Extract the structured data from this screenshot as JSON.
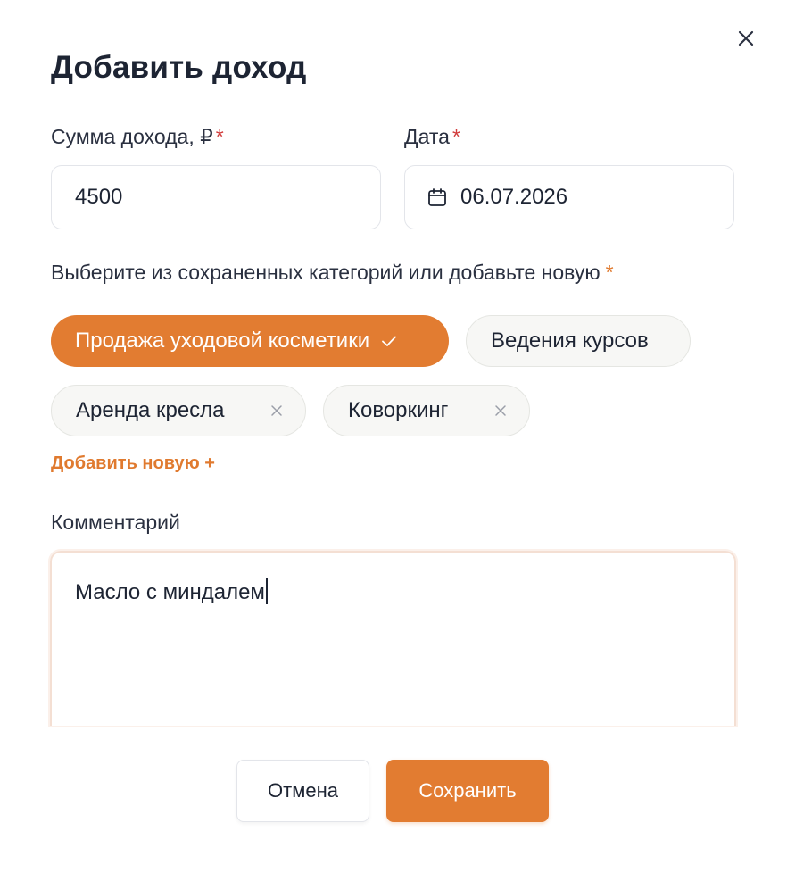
{
  "dialog": {
    "title": "Добавить доход",
    "close_icon": "close-icon"
  },
  "form": {
    "amount": {
      "label": "Сумма дохода, ₽",
      "required_mark": "*",
      "value": "4500"
    },
    "date": {
      "label": "Дата",
      "required_mark": "*",
      "value": "06.07.2026",
      "icon": "calendar-icon"
    },
    "categories": {
      "label": "Выберите из сохраненных категорий или добавьте новую",
      "required_mark": "*",
      "items": [
        {
          "label": "Продажа уходовой косметики",
          "selected": true,
          "icon": "check-icon"
        },
        {
          "label": "Ведения курсов",
          "selected": false
        },
        {
          "label": "Аренда кресла",
          "selected": false,
          "icon": "remove-icon"
        },
        {
          "label": "Коворкинг",
          "selected": false,
          "icon": "remove-icon"
        }
      ],
      "add_new_label": "Добавить новую +"
    },
    "comment": {
      "label": "Комментарий",
      "value": "Масло с миндалем"
    }
  },
  "actions": {
    "cancel_label": "Отмена",
    "save_label": "Сохранить"
  },
  "colors": {
    "accent": "#e27c31",
    "required": "#d13b3b",
    "text": "#1d2433"
  }
}
